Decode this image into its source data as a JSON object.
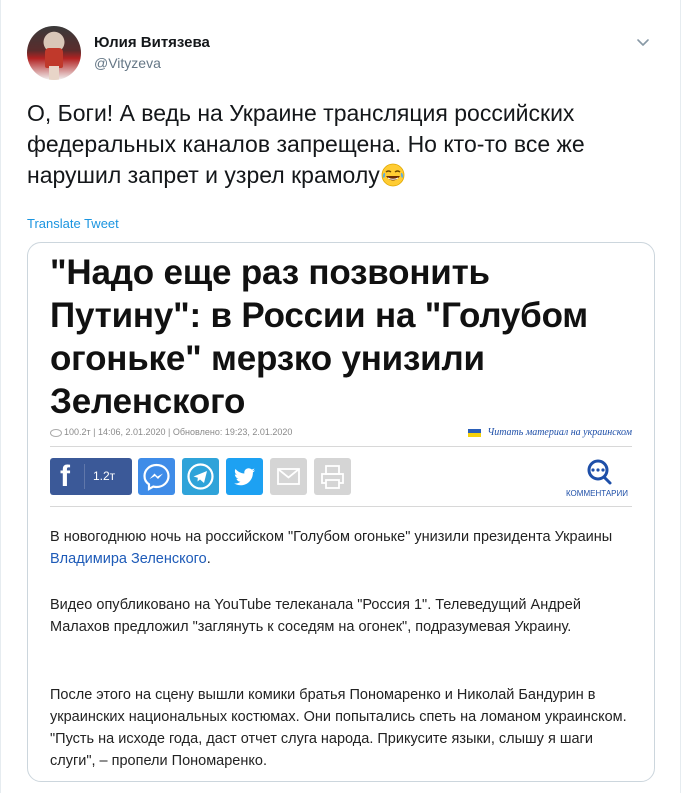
{
  "user": {
    "display_name": "Юлия Витязева",
    "handle": "@Vityzeva"
  },
  "tweet": {
    "text": "О, Боги! А ведь на Украине трансляция российских федеральных каналов запрещена. Но кто-то все же нарушил запрет и узрел крамолу",
    "emoji": "face-with-tears-of-joy-icon",
    "translate_label": "Translate Tweet"
  },
  "article": {
    "headline": "\"Надо еще раз позвонить Путину\": в России на \"Голубом огоньке\" мерзко унизили Зеленского",
    "meta": "100.2т  |  14:06, 2.01.2020  |  Обновлено: 19:23, 2.01.2020",
    "ua_link": "Читать материал на украинском",
    "share": {
      "fb_count": "1.2т",
      "comments_label": "КОММЕНТАРИИ"
    },
    "p1_before": "В новогоднюю ночь на российском \"Голубом огоньке\" унизили президента Украины ",
    "p1_link": "Владимира Зеленского",
    "p1_after": ".",
    "p2": "Видео опубликовано на YouTube телеканала \"Россия 1\". Телеведущий Андрей Малахов предложил \"заглянуть к соседям на огонек\", подразумевая Украину.",
    "p3": "После этого на сцену вышли комики братья Пономаренко и Николай Бандурин в украинских национальных костюмах. Они попытались спеть на ломаном украинском. \"Пусть на исходе года, даст отчет слуга народа. Прикусите языки, слышу я шаги слуги\", – пропели Пономаренко."
  },
  "colors": {
    "link_blue": "#1b95e0",
    "facebook": "#3b5998",
    "messenger": "#3f8ce8",
    "telegram": "#2fa3d9",
    "twitter": "#1da1f2"
  }
}
